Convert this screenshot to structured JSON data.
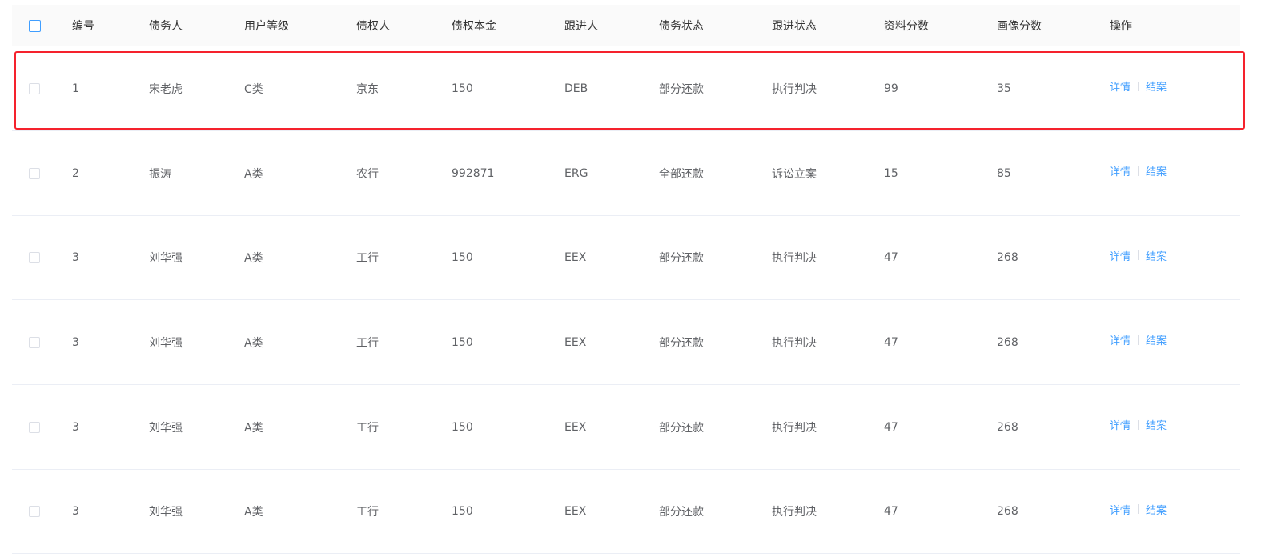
{
  "table": {
    "columns": [
      "编号",
      "债务人",
      "用户等级",
      "债权人",
      "债权本金",
      "跟进人",
      "债务状态",
      "跟进状态",
      "资料分数",
      "画像分数",
      "操作"
    ],
    "actions": {
      "detail": "详情",
      "close": "结案"
    },
    "rows": [
      [
        "1",
        "宋老虎",
        "C类",
        "京东",
        "150",
        "DEB",
        "部分还款",
        "执行判决",
        "99",
        "35"
      ],
      [
        "2",
        "振涛",
        "A类",
        "农行",
        "992871",
        "ERG",
        "全部还款",
        "诉讼立案",
        "15",
        "85"
      ],
      [
        "3",
        "刘华强",
        "A类",
        "工行",
        "150",
        "EEX",
        "部分还款",
        "执行判决",
        "47",
        "268"
      ],
      [
        "3",
        "刘华强",
        "A类",
        "工行",
        "150",
        "EEX",
        "部分还款",
        "执行判决",
        "47",
        "268"
      ],
      [
        "3",
        "刘华强",
        "A类",
        "工行",
        "150",
        "EEX",
        "部分还款",
        "执行判决",
        "47",
        "268"
      ],
      [
        "3",
        "刘华强",
        "A类",
        "工行",
        "150",
        "EEX",
        "部分还款",
        "执行判决",
        "47",
        "268"
      ]
    ],
    "highlight_color": "#f5222d",
    "link_color": "#409eff",
    "header_checkbox_color": "#409eff"
  }
}
